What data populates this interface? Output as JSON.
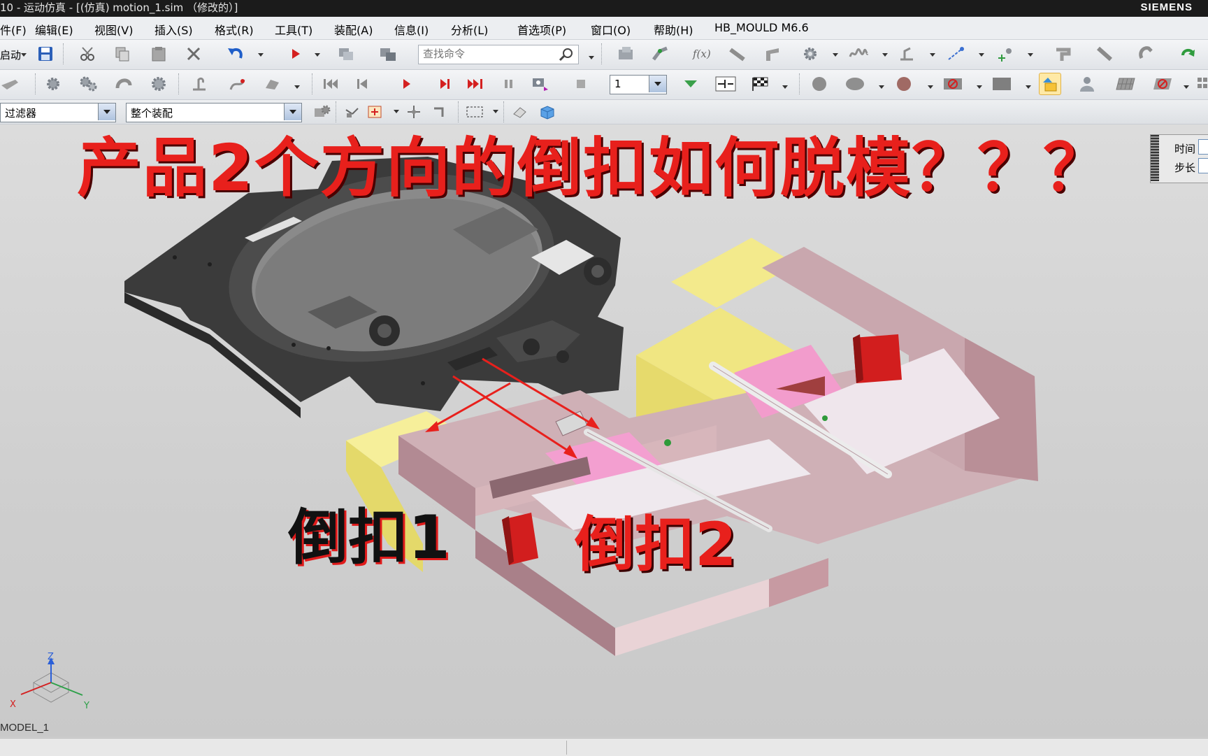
{
  "titlebar": {
    "title": "10 - 运动仿真 - [(仿真) motion_1.sim （修改的）]",
    "brand": "SIEMENS"
  },
  "menu": [
    {
      "label": "件(F)"
    },
    {
      "label": "编辑(E)"
    },
    {
      "label": "视图(V)"
    },
    {
      "label": "插入(S)"
    },
    {
      "label": "格式(R)"
    },
    {
      "label": "工具(T)"
    },
    {
      "label": "装配(A)"
    },
    {
      "label": "信息(I)"
    },
    {
      "label": "分析(L)"
    },
    {
      "label": "首选项(P)"
    },
    {
      "label": "窗口(O)"
    },
    {
      "label": "帮助(H)"
    },
    {
      "label": "HB_MOULD M6.6"
    }
  ],
  "toolbar1": {
    "start_label": "启动",
    "search_placeholder": "查找命令"
  },
  "toolbar2": {
    "step_value": "1"
  },
  "selection_bar": {
    "filter_value": "过滤器",
    "scope_value": "整个装配"
  },
  "side_panel": {
    "time_label": "时间",
    "step_label": "步长"
  },
  "overlay": {
    "headline": "产品2个方向的倒扣如何脱模？？？",
    "undercut_1": "倒扣1",
    "undercut_2": "倒扣2"
  },
  "viewport": {
    "model_label": "MODEL_1",
    "axis_x": "X",
    "axis_y": "Y",
    "axis_z": "Z"
  },
  "colors": {
    "title_red": "#e8201c",
    "product_gray": "#3d3d3d",
    "slider_yellow": "#f3e98a",
    "mold_mauve": "#c9a7ae",
    "insert_pink": "#f08cc4",
    "lock_red": "#d21e1e"
  }
}
